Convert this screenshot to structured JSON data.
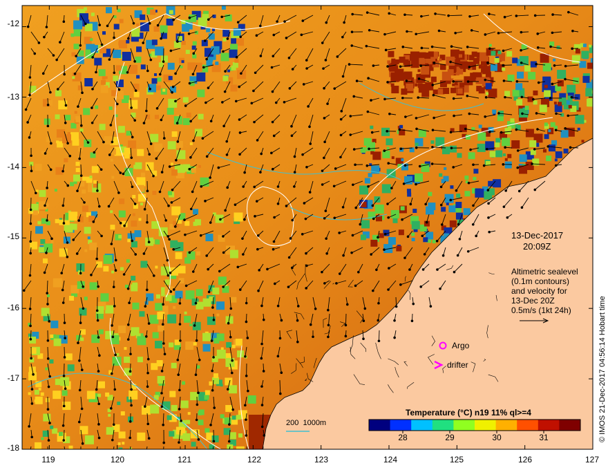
{
  "map": {
    "lon_ticks": [
      "119",
      "120",
      "121",
      "122",
      "123",
      "124",
      "125",
      "126",
      "127"
    ],
    "lat_ticks": [
      "-12",
      "-13",
      "-14",
      "-15",
      "-16",
      "-17",
      "-18"
    ],
    "lon_range": [
      118.6,
      127.0
    ],
    "lat_range": [
      -18.0,
      -11.7
    ]
  },
  "annotation": {
    "date": "13-Dec-2017",
    "time": "20:09Z",
    "legend_lines": [
      "Altimetric sealevel",
      "(0.1m contours)",
      "and velocity for",
      "13-Dec 20Z",
      "0.5m/s (1kt 24h)"
    ]
  },
  "markers": {
    "argo_label": "Argo",
    "drifter_label": "drifter",
    "argo_color": "#ff00ff",
    "drifter_color": "#ff00ff"
  },
  "bathymetry": {
    "label": "200  1000m",
    "color": "#40c0d0"
  },
  "colorbar": {
    "title": "Temperature (°C) n19 11% ql>=4",
    "ticks": [
      "28",
      "29",
      "30",
      "31"
    ],
    "colors": [
      "#00007f",
      "#0030ff",
      "#00c0ff",
      "#20e080",
      "#90ff20",
      "#f0f000",
      "#ffb000",
      "#ff5000",
      "#c01000",
      "#7f0000"
    ]
  },
  "credit": "© IMOS 21-Dec-2017 04:56:14 Hobart time",
  "land_color": "#fbc9a0"
}
